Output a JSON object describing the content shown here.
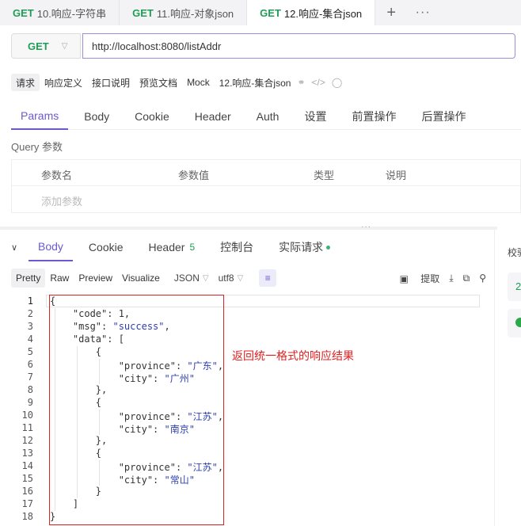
{
  "request_tabs": [
    {
      "method": "GET",
      "label": "10.响应-字符串"
    },
    {
      "method": "GET",
      "label": "11.响应-对象json"
    },
    {
      "method": "GET",
      "label": "12.响应-集合json"
    }
  ],
  "tab_actions": {
    "add": "+",
    "more": "···"
  },
  "url_bar": {
    "method": "GET",
    "url": "http://localhost:8080/listAddr"
  },
  "doc_tabs": [
    "请求",
    "响应定义",
    "接口说明",
    "预览文档",
    "Mock"
  ],
  "doc_name": "12.响应-集合json",
  "param_tabs": [
    "Params",
    "Body",
    "Cookie",
    "Header",
    "Auth",
    "设置",
    "前置操作",
    "后置操作"
  ],
  "query": {
    "title": "Query 参数",
    "columns": [
      "参数名",
      "参数值",
      "类型",
      "说明"
    ],
    "placeholder": "添加参数"
  },
  "response_tabs": {
    "body": "Body",
    "cookie": "Cookie",
    "header": "Header",
    "header_count": "5",
    "console": "控制台",
    "actual": "实际请求"
  },
  "format_bar": {
    "modes": [
      "Pretty",
      "Raw",
      "Preview",
      "Visualize"
    ],
    "format": "JSON",
    "encoding": "utf8",
    "extract": "提取"
  },
  "code_lines": [
    {
      "n": "1",
      "t": "{"
    },
    {
      "n": "2",
      "t": "    \"code\": 1,"
    },
    {
      "n": "3",
      "t": "    \"msg\": \"success\","
    },
    {
      "n": "4",
      "t": "    \"data\": ["
    },
    {
      "n": "5",
      "t": "        {"
    },
    {
      "n": "6",
      "t": "            \"province\": \"广东\","
    },
    {
      "n": "7",
      "t": "            \"city\": \"广州\""
    },
    {
      "n": "8",
      "t": "        },"
    },
    {
      "n": "9",
      "t": "        {"
    },
    {
      "n": "10",
      "t": "            \"province\": \"江苏\","
    },
    {
      "n": "11",
      "t": "            \"city\": \"南京\""
    },
    {
      "n": "12",
      "t": "        },"
    },
    {
      "n": "13",
      "t": "        {"
    },
    {
      "n": "14",
      "t": "            \"province\": \"江苏\","
    },
    {
      "n": "15",
      "t": "            \"city\": \"常山\""
    },
    {
      "n": "16",
      "t": "        }"
    },
    {
      "n": "17",
      "t": "    ]"
    },
    {
      "n": "18",
      "t": "}"
    }
  ],
  "annotation": "返回统一格式的响应结果",
  "right_panel": {
    "title": "校验",
    "status": "2"
  },
  "colors": {
    "accent": "#6a5acd",
    "get": "#1f9d55",
    "string": "#2e3fb0",
    "annotation": "#e02020"
  }
}
